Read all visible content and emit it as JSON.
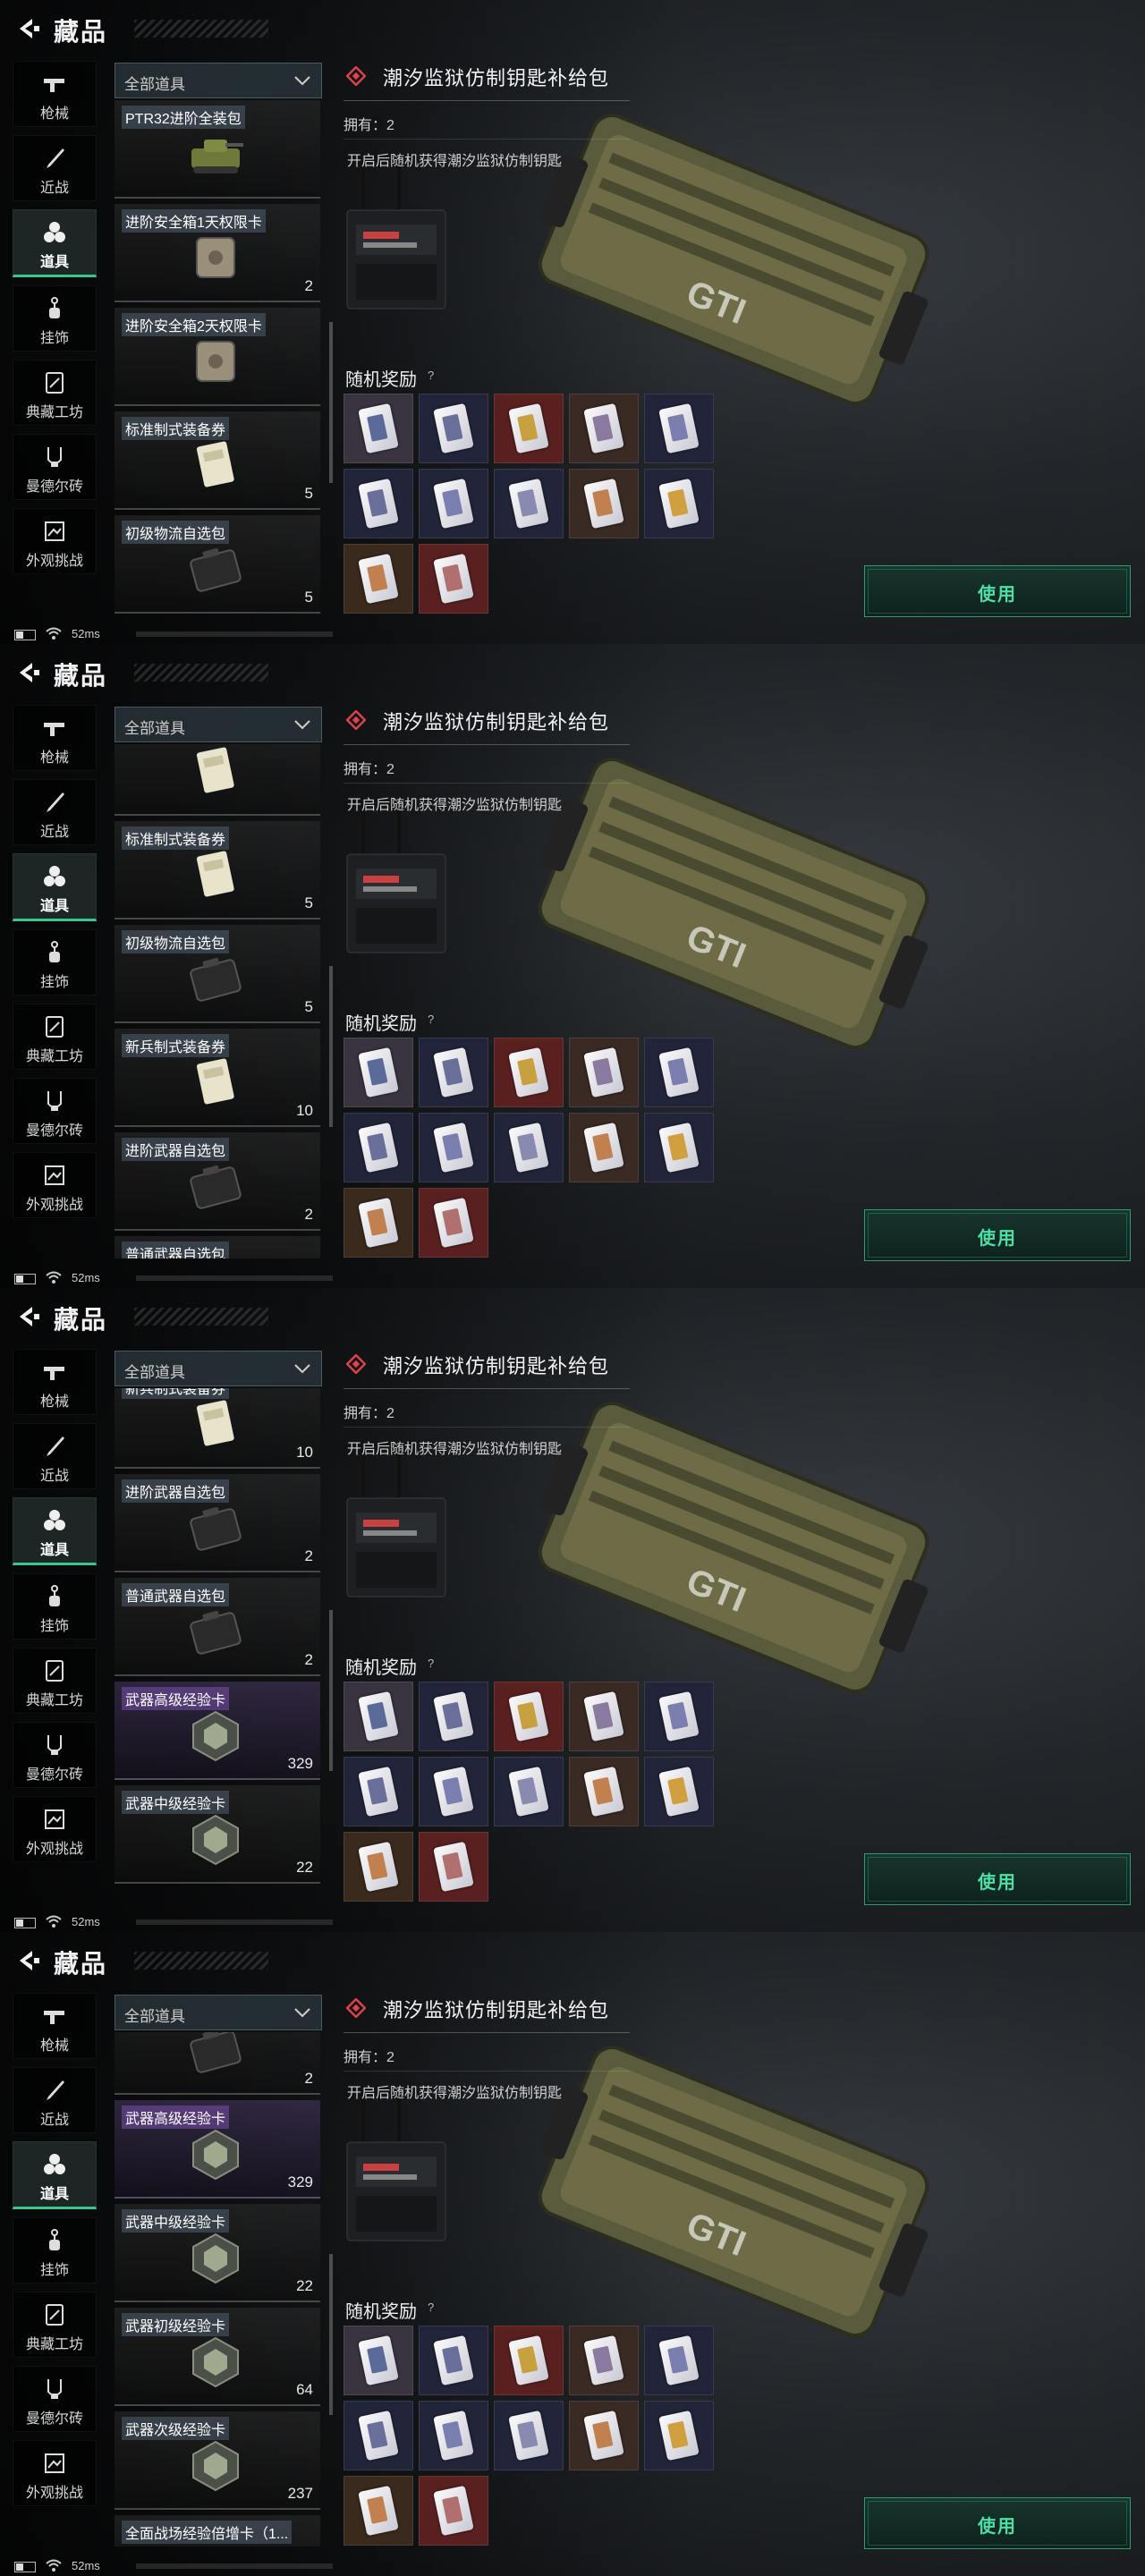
{
  "screen": {
    "title": "藏品",
    "categories": [
      {
        "label": "枪械",
        "icon": "gun-icon"
      },
      {
        "label": "近战",
        "icon": "knife-icon"
      },
      {
        "label": "道具",
        "icon": "items-icon"
      },
      {
        "label": "挂饰",
        "icon": "charm-icon"
      },
      {
        "label": "典藏工坊",
        "icon": "workshop-icon"
      },
      {
        "label": "曼德尔砖",
        "icon": "brick-icon"
      },
      {
        "label": "外观挑战",
        "icon": "challenge-icon"
      }
    ],
    "active_category": "道具",
    "filter_label": "全部道具",
    "detail": {
      "name": "潮汐监狱仿制钥匙补给包",
      "owned": "拥有：2",
      "description": "开启后随机获得潮汐监狱仿制钥匙",
      "rewards_label": "随机奖励",
      "rewards_hint": "?",
      "use_label": "使用"
    },
    "status": {
      "ping": "52ms"
    }
  },
  "lists": [
    [
      {
        "name": "PTR32进阶全装包",
        "count": "",
        "rarity": "normal",
        "image": "tank-icon"
      },
      {
        "name": "进阶安全箱1天权限卡",
        "count": "2",
        "rarity": "normal",
        "image": "safe-icon"
      },
      {
        "name": "进阶安全箱2天权限卡",
        "count": "",
        "rarity": "normal",
        "image": "safe-icon"
      },
      {
        "name": "标准制式装备券",
        "count": "5",
        "rarity": "normal",
        "image": "voucher-icon"
      },
      {
        "name": "初级物流自选包",
        "count": "5",
        "rarity": "normal",
        "image": "case-icon"
      }
    ],
    [
      {
        "name": "",
        "count": "",
        "rarity": "normal",
        "image": "voucher-icon"
      },
      {
        "name": "标准制式装备券",
        "count": "5",
        "rarity": "normal",
        "image": "voucher-icon"
      },
      {
        "name": "初级物流自选包",
        "count": "5",
        "rarity": "normal",
        "image": "case-icon"
      },
      {
        "name": "新兵制式装备券",
        "count": "10",
        "rarity": "normal",
        "image": "voucher-icon"
      },
      {
        "name": "进阶武器自选包",
        "count": "2",
        "rarity": "normal",
        "image": "case-icon"
      },
      {
        "name": "普通武器自选包",
        "count": "",
        "rarity": "normal",
        "image": "case-icon"
      }
    ],
    [
      {
        "name": "新兵制式装备券",
        "count": "10",
        "rarity": "normal",
        "image": "voucher-icon"
      },
      {
        "name": "进阶武器自选包",
        "count": "2",
        "rarity": "normal",
        "image": "case-icon"
      },
      {
        "name": "普通武器自选包",
        "count": "2",
        "rarity": "normal",
        "image": "case-icon"
      },
      {
        "name": "武器高级经验卡",
        "count": "329",
        "rarity": "purple",
        "image": "exp-card-icon"
      },
      {
        "name": "武器中级经验卡",
        "count": "22",
        "rarity": "normal",
        "image": "exp-card-icon"
      }
    ],
    [
      {
        "name": "",
        "count": "2",
        "rarity": "normal",
        "image": "case-icon"
      },
      {
        "name": "武器高级经验卡",
        "count": "329",
        "rarity": "purple",
        "image": "exp-card-icon"
      },
      {
        "name": "武器中级经验卡",
        "count": "22",
        "rarity": "normal",
        "image": "exp-card-icon"
      },
      {
        "name": "武器初级经验卡",
        "count": "64",
        "rarity": "normal",
        "image": "exp-card-icon"
      },
      {
        "name": "武器次级经验卡",
        "count": "237",
        "rarity": "normal",
        "image": "exp-card-icon"
      },
      {
        "name": "全面战场经验倍增卡（1...",
        "count": "",
        "rarity": "normal",
        "image": "case-icon"
      }
    ]
  ],
  "reward_cells": [
    {
      "bg": "#3a3440",
      "inner": "#5a6b9a"
    },
    {
      "bg": "#22243a",
      "inner": "#6a6f9a"
    },
    {
      "bg": "#5a2020",
      "inner": "#c8a040"
    },
    {
      "bg": "#3a2a24",
      "inner": "#8a7aa0"
    },
    {
      "bg": "#22243a",
      "inner": "#7a7fb0"
    },
    {
      "bg": "#22243a",
      "inner": "#6a6f9a"
    },
    {
      "bg": "#22243a",
      "inner": "#7a7fb0"
    },
    {
      "bg": "#22243a",
      "inner": "#8a8ab0"
    },
    {
      "bg": "#3a2a24",
      "inner": "#c08050"
    },
    {
      "bg": "#22243a",
      "inner": "#d0a040"
    },
    {
      "bg": "#3a2a1e",
      "inner": "#c08050"
    },
    {
      "bg": "#5a2020",
      "inner": "#b07070"
    }
  ],
  "colors": {
    "accent": "#3cc68f",
    "use_text": "#4fe0a4",
    "diamond": "#d9434b"
  }
}
